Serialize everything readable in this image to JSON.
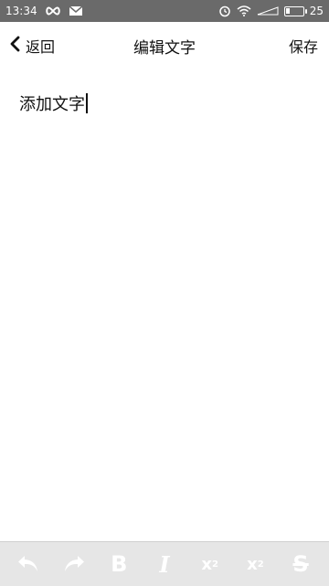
{
  "status_bar": {
    "time": "13:34",
    "battery_level": "25",
    "battery_fraction": 0.25,
    "icons": [
      "infinity-icon",
      "mail-icon",
      "alarm-icon",
      "wifi-icon",
      "signal-icon",
      "battery-icon"
    ]
  },
  "nav": {
    "back_label": "返回",
    "title": "编辑文字",
    "save_label": "保存"
  },
  "editor": {
    "text": "添加文字"
  },
  "toolbar": {
    "tools": [
      "undo-icon",
      "redo-icon",
      "bold-icon",
      "italic-icon",
      "subscript-icon",
      "superscript-icon",
      "strikethrough-icon"
    ],
    "bold_glyph": "B",
    "italic_glyph": "I",
    "subscript_base": "x",
    "subscript_mark": "2",
    "superscript_base": "x",
    "superscript_mark": "2",
    "strike_glyph": "S"
  },
  "colors": {
    "status_bar_bg": "#6a6a6a",
    "toolbar_bg": "#e6e6e6",
    "toolbar_icon": "#ffffff"
  }
}
